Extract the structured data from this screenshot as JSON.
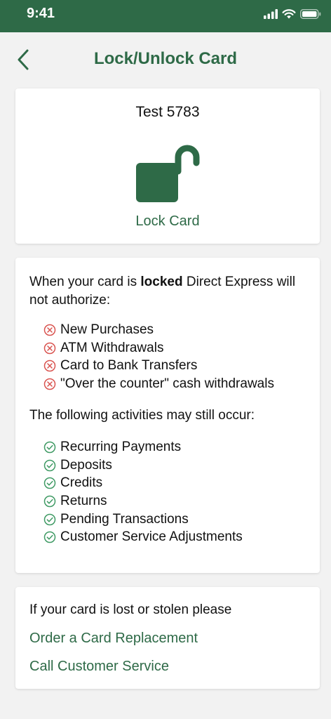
{
  "status_bar": {
    "time": "9:41"
  },
  "header": {
    "title": "Lock/Unlock Card"
  },
  "card": {
    "name": "Test 5783",
    "lock_action": "Lock Card"
  },
  "info": {
    "intro_prefix": "When your card is ",
    "intro_bold": "locked",
    "intro_suffix": " Direct Express will not authorize:",
    "blocked": [
      "New Purchases",
      "ATM Withdrawals",
      "Card to Bank Transfers",
      "\"Over the counter\" cash withdrawals"
    ],
    "still_occur": "The following activities may still occur:",
    "allowed": [
      "Recurring Payments",
      "Deposits",
      "Credits",
      "Returns",
      "Pending Transactions",
      "Customer Service Adjustments"
    ]
  },
  "lost": {
    "text": "If your card is lost or stolen please",
    "replace_link": "Order a Card Replacement",
    "call_link": "Call Customer Service"
  },
  "colors": {
    "brand_green": "#2e6a47",
    "blocked_red": "#d9534f",
    "allowed_green": "#3f9a64"
  }
}
